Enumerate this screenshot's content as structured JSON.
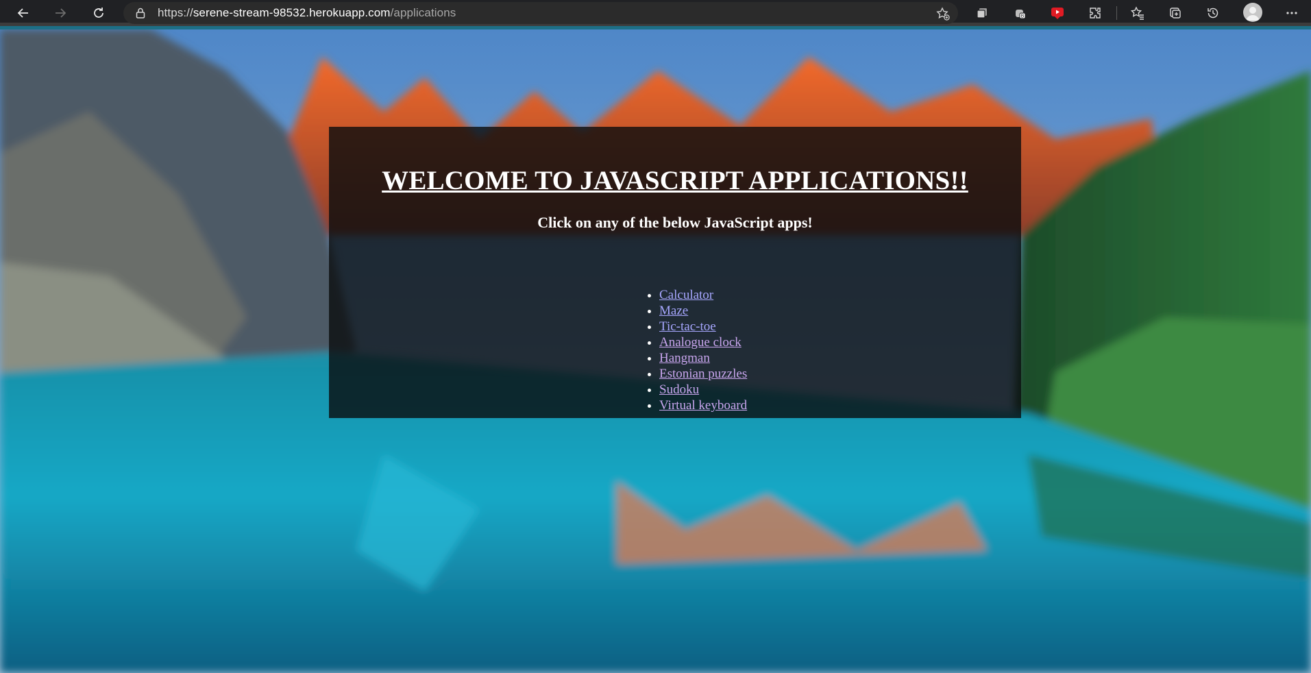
{
  "browser": {
    "url_scheme": "https://",
    "url_host": "serene-stream-98532.herokuapp.com",
    "url_path": "/applications",
    "toolbar_icons": [
      "back-icon",
      "forward-icon",
      "refresh-icon",
      "lock-icon",
      "add-favorite-icon",
      "collections-icon",
      "extension-icon",
      "video-extension-icon",
      "puzzle-extensions-icon",
      "favorites-icon",
      "split-screen-icon",
      "history-icon",
      "profile-avatar",
      "more-icon"
    ]
  },
  "page": {
    "title": "WELCOME TO JAVASCRIPT APPLICATIONS!!",
    "subtitle": "Click on any of the below JavaScript apps!",
    "apps": [
      {
        "label": "Calculator"
      },
      {
        "label": "Maze"
      },
      {
        "label": "Tic-tac-toe"
      },
      {
        "label": "Analogue clock"
      },
      {
        "label": "Hangman"
      },
      {
        "label": "Estonian puzzles"
      },
      {
        "label": "Sudoku"
      },
      {
        "label": "Virtual keyboard"
      }
    ],
    "colors": {
      "link": "#a7a7ff",
      "visited_link": "#c9a6ef",
      "panel": "rgba(10,12,14,0.80)"
    }
  }
}
